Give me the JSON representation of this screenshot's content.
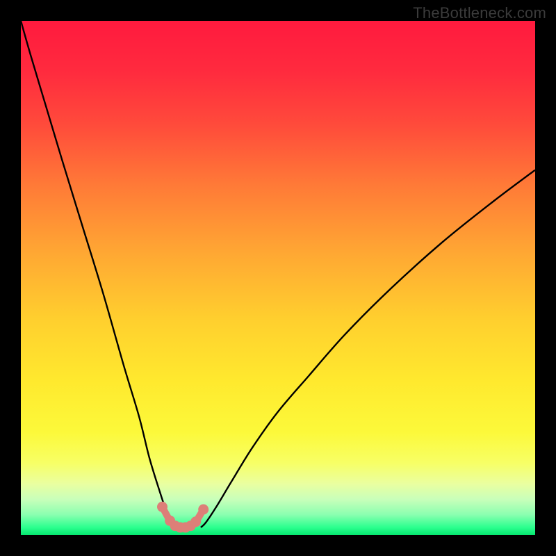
{
  "watermark": "TheBottleneck.com",
  "chart_data": {
    "type": "line",
    "title": "",
    "xlabel": "",
    "ylabel": "",
    "xlim": [
      0,
      100
    ],
    "ylim": [
      0,
      100
    ],
    "grid": false,
    "legend": false,
    "series": [
      {
        "name": "bottleneck-curve-left",
        "x": [
          0,
          2,
          5,
          8,
          12,
          16,
          20,
          23,
          25,
          27,
          28.5,
          29.5,
          30.5
        ],
        "y": [
          100,
          93,
          83,
          73,
          60,
          47,
          33,
          23,
          15,
          8.5,
          4,
          2,
          1.5
        ],
        "color": "#000000"
      },
      {
        "name": "bottleneck-curve-right",
        "x": [
          35,
          36,
          38,
          41,
          45,
          50,
          56,
          63,
          72,
          82,
          92,
          100
        ],
        "y": [
          1.5,
          2.5,
          5.5,
          10.5,
          17,
          24,
          31,
          39,
          48,
          57,
          65,
          71
        ],
        "color": "#000000"
      },
      {
        "name": "optimal-range-markers",
        "x": [
          27.5,
          29,
          30,
          31,
          32,
          33,
          34,
          35.5
        ],
        "y": [
          5.5,
          2.8,
          1.8,
          1.5,
          1.5,
          1.8,
          2.6,
          5.0
        ],
        "color": "#dd7f78"
      }
    ],
    "gradient_stops": [
      {
        "offset": 0.0,
        "color": "#ff1a3e"
      },
      {
        "offset": 0.1,
        "color": "#ff2b3e"
      },
      {
        "offset": 0.2,
        "color": "#ff4a3b"
      },
      {
        "offset": 0.32,
        "color": "#ff7a37"
      },
      {
        "offset": 0.45,
        "color": "#ffa733"
      },
      {
        "offset": 0.58,
        "color": "#ffcf2e"
      },
      {
        "offset": 0.7,
        "color": "#ffe92e"
      },
      {
        "offset": 0.8,
        "color": "#fcf93a"
      },
      {
        "offset": 0.86,
        "color": "#f7ff66"
      },
      {
        "offset": 0.9,
        "color": "#eaffa0"
      },
      {
        "offset": 0.93,
        "color": "#c9ffba"
      },
      {
        "offset": 0.96,
        "color": "#8bffb0"
      },
      {
        "offset": 0.985,
        "color": "#2bff8e"
      },
      {
        "offset": 1.0,
        "color": "#05e66f"
      }
    ],
    "comment": "Values are approximate percentages of the visible plot area: x=0 left edge, x=100 right edge; y=0 bottom edge, y=100 top edge."
  }
}
